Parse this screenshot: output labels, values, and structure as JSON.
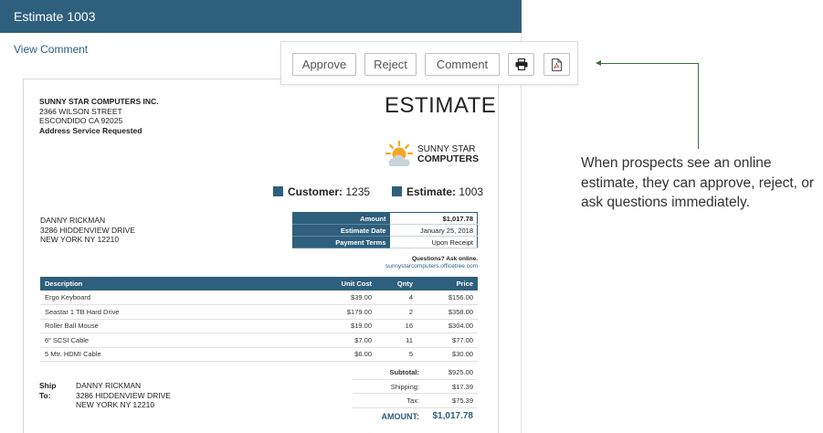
{
  "window": {
    "title": "Estimate 1003"
  },
  "view_comment": "View Comment",
  "toolbar": {
    "approve": "Approve",
    "reject": "Reject",
    "comment": "Comment",
    "print_icon": "printer-icon",
    "pdf_icon": "pdf-icon"
  },
  "sender": {
    "company": "SUNNY STAR COMPUTERS INC.",
    "street": "2366 WILSON STREET",
    "city": "ESCONDIDO CA  92025",
    "note": "Address Service Requested"
  },
  "document_title": "ESTIMATE",
  "logo": {
    "line1": "SUNNY STAR",
    "line2": "COMPUTERS"
  },
  "tags": {
    "customer_label": "Customer:",
    "customer_value": "1235",
    "estimate_label": "Estimate:",
    "estimate_value": "1003"
  },
  "customer": {
    "name": "DANNY RICKMAN",
    "street": "3286 HIDDENVIEW DRIVE",
    "city": "NEW YORK NY  12210"
  },
  "summary": [
    {
      "label": "Amount",
      "value": "$1,017.78"
    },
    {
      "label": "Estimate Date",
      "value": "January 25, 2018"
    },
    {
      "label": "Payment Terms",
      "value": "Upon Receipt"
    }
  ],
  "questions": {
    "line1": "Questions? Ask online.",
    "line2": "sunnystarcomputers.officetree.com"
  },
  "items": {
    "headers": [
      "Description",
      "Unit Cost",
      "Qnty",
      "Price"
    ],
    "rows": [
      [
        "Ergo Keyboard",
        "$39.00",
        "4",
        "$156.00"
      ],
      [
        "Seastar 1 TB Hard Drive",
        "$179.00",
        "2",
        "$358.00"
      ],
      [
        "Roller Ball Mouse",
        "$19.00",
        "16",
        "$304.00"
      ],
      [
        "6\" SCSI Cable",
        "$7.00",
        "11",
        "$77.00"
      ],
      [
        "5 Mtr. HDMI Cable",
        "$6.00",
        "5",
        "$30.00"
      ]
    ]
  },
  "ship_to": {
    "label": "Ship To:",
    "name": "DANNY RICKMAN",
    "street": "3286 HIDDENVIEW DRIVE",
    "city": "NEW YORK NY  12210"
  },
  "totals": {
    "subtotal_label": "Subtotal:",
    "subtotal": "$925.00",
    "shipping_label": "Shipping:",
    "shipping": "$17.39",
    "tax_label": "Tax:",
    "tax": "$75.39",
    "amount_label": "AMOUNT:",
    "amount": "$1,017.78"
  },
  "callout": "When prospects see an online estimate, they can approve, reject, or ask questions immediately.",
  "colors": {
    "brand": "#2e5f7d",
    "connector": "#3e6b3e"
  }
}
